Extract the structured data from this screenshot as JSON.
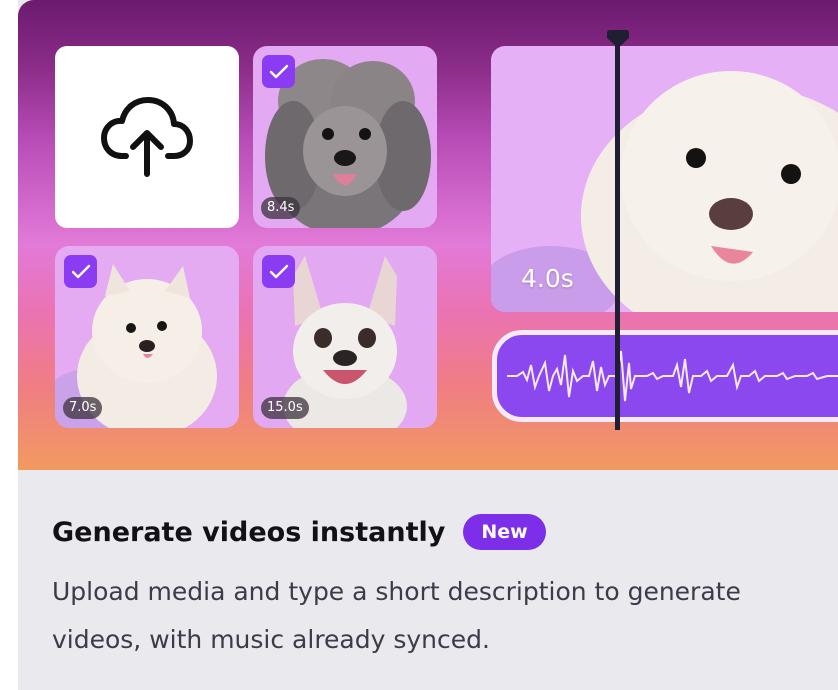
{
  "card": {
    "title": "Generate videos instantly",
    "badge": "New",
    "description": "Upload media and type a short description to generate videos, with music already synced."
  },
  "media": {
    "upload_icon": "cloud-upload-icon",
    "tiles": [
      {
        "name": "poodle",
        "duration": "8.4s",
        "selected": true
      },
      {
        "name": "pomeranian",
        "duration": "7.0s",
        "selected": true
      },
      {
        "name": "bulldog",
        "duration": "15.0s",
        "selected": true
      }
    ]
  },
  "preview": {
    "duration": "4.0s"
  },
  "colors": {
    "accent": "#7d2ee8",
    "check_bg": "#8b3cf3",
    "audio_track": "#8b48ef",
    "playhead": "#1e1f33"
  }
}
